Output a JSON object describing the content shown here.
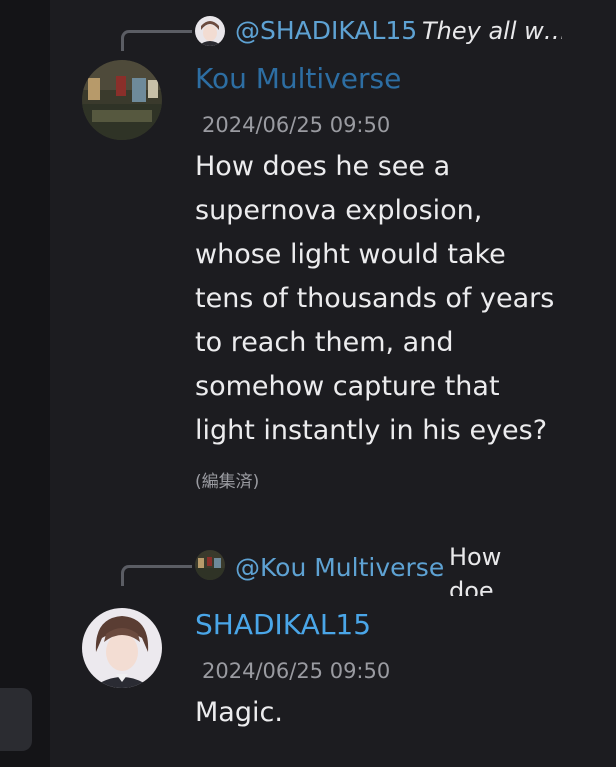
{
  "colors": {
    "background": "#1c1c20",
    "username_blue_dark": "#2d6ea3",
    "username_blue_light": "#4aa6e8",
    "reply_name": "#5ea2d3",
    "muted": "#9a9ba1",
    "text": "#ececee"
  },
  "messages": [
    {
      "reply": {
        "mention": "@SHADIKAL15",
        "snippet": "They all w…"
      },
      "author": "Kou Multiverse",
      "timestamp": "2024/06/25 09:50",
      "content": "How does he see a\nsupernova explosion,\nwhose light would take\ntens of thousands of years\nto reach them, and\nsomehow capture that\nlight instantly in his eyes?",
      "edited_label": "(編集済)"
    },
    {
      "reply": {
        "mention": "@Kou Multiverse",
        "snippet": "How doe…\nhe see a s…"
      },
      "author": "SHADIKAL15",
      "timestamp": "2024/06/25 09:50",
      "content": "Magic."
    }
  ]
}
